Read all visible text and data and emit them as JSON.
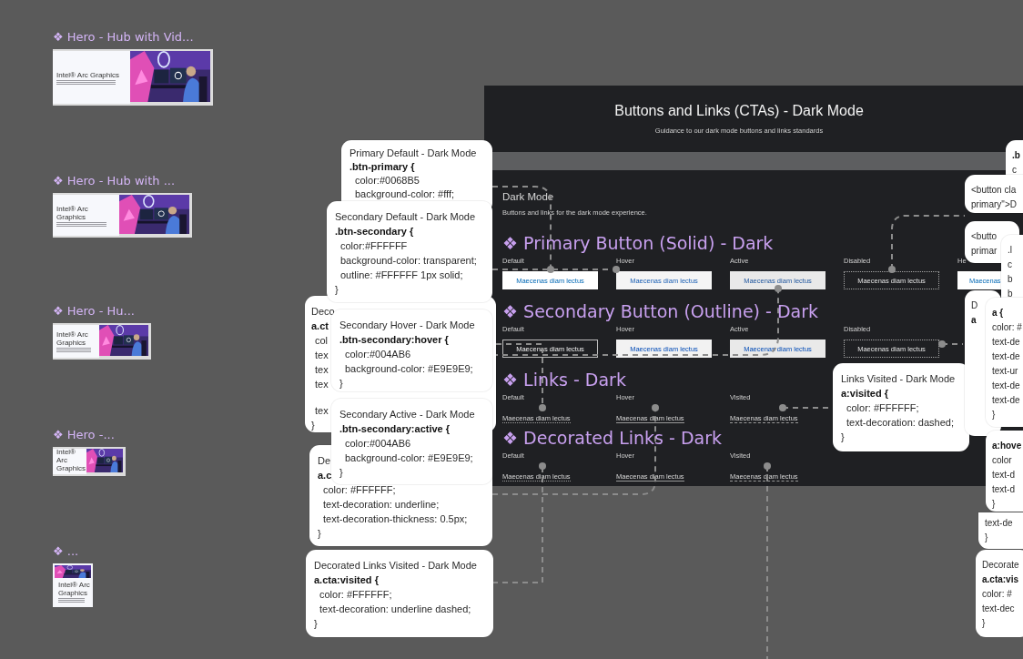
{
  "frames": [
    {
      "label": "❖ Hero - Hub with Vid...",
      "heading": "Intel® Arc Graphics"
    },
    {
      "label": "❖ Hero - Hub with ...",
      "heading": "Intel® Arc Graphics"
    },
    {
      "label": "❖ Hero - Hu...",
      "heading": "Intel® Arc Graphics"
    },
    {
      "label": "❖ Hero -...",
      "heading": "Intel® Arc Graphics"
    },
    {
      "label": "❖ ...",
      "heading": "Intel® Arc Graphics"
    }
  ],
  "board": {
    "title": "Buttons and Links (CTAs) - Dark Mode",
    "subtitle": "Guidance to our dark mode buttons and links standards",
    "section_title": "Dark Mode",
    "section_description": "Buttons and links for the dark mode experience.",
    "groups": [
      {
        "label": "❖ Primary Button (Solid) - Dark",
        "kind": "solid",
        "states": [
          {
            "label": "Default",
            "text": "Maecenas diam lectus",
            "kind": "default"
          },
          {
            "label": "Hover",
            "text": "Maecenas diam lectus",
            "kind": "hover"
          },
          {
            "label": "Active",
            "text": "Maecenas diam lectus",
            "kind": "active"
          },
          {
            "label": "Disabled",
            "text": "Maecenas diam lectus",
            "kind": "disabled"
          },
          {
            "label": "He",
            "text": "Maecenas",
            "kind": "default"
          }
        ]
      },
      {
        "label": "❖ Secondary Button (Outline) - Dark",
        "kind": "outline",
        "states": [
          {
            "label": "Default",
            "text": "Maecenas diam lectus",
            "kind": "default"
          },
          {
            "label": "Hover",
            "text": "Maecenas diam lectus",
            "kind": "hover"
          },
          {
            "label": "Active",
            "text": "Maecenas diam lectus",
            "kind": "active"
          },
          {
            "label": "Disabled",
            "text": "Maecenas diam lectus",
            "kind": "disabled"
          }
        ]
      },
      {
        "label": "❖ Links - Dark",
        "kind": "link",
        "states": [
          {
            "label": "Default",
            "text": "Maecenas diam lectus",
            "kind": "default"
          },
          {
            "label": "Hover",
            "text": "Maecenas diam lectus",
            "kind": "hover"
          },
          {
            "label": "Visited",
            "text": "Maecenas diam lectus",
            "kind": "visited"
          }
        ]
      },
      {
        "label": "❖ Decorated Links - Dark",
        "kind": "link",
        "states": [
          {
            "label": "Default",
            "text": "Maecenas diam lectus",
            "kind": "default"
          },
          {
            "label": "Hover",
            "text": "Maecenas diam lectus",
            "kind": "hover"
          },
          {
            "label": "Visited",
            "text": "Maecenas diam lectus",
            "kind": "visited"
          }
        ]
      }
    ]
  },
  "notes": [
    {
      "lines": [
        {
          "text": "Primary Default - Dark Mode",
          "kind": "title"
        },
        {
          "text": ".btn-primary {",
          "kind": "selector"
        },
        {
          "text": "color:#0068B5",
          "kind": "prop"
        },
        {
          "text": "background-color: #fff;",
          "kind": "prop"
        }
      ]
    },
    {
      "lines": [
        {
          "text": "Deco",
          "kind": "title"
        },
        {
          "text": "a.ct",
          "kind": "selector"
        },
        {
          "text": "col",
          "kind": "prop"
        },
        {
          "text": "tex",
          "kind": "prop"
        },
        {
          "text": "tex",
          "kind": "prop"
        },
        {
          "text": "tex",
          "kind": "prop"
        },
        {
          "text": "tex",
          "kind": "prop"
        },
        {
          "text": "}",
          "kind": "close"
        }
      ]
    },
    {
      "lines": [
        {
          "text": "Secondary Default - Dark Mode",
          "kind": "title"
        },
        {
          "text": ".btn-secondary {",
          "kind": "selector"
        },
        {
          "text": "color:#FFFFFF",
          "kind": "prop"
        },
        {
          "text": "background-color: transparent;",
          "kind": "prop"
        },
        {
          "text": "outline: #FFFFFF 1px solid;",
          "kind": "prop"
        },
        {
          "text": "}",
          "kind": "close"
        }
      ]
    },
    {
      "lines": [
        {
          "text": "Secondary Hover - Dark Mode",
          "kind": "title"
        },
        {
          "text": ".btn-secondary:hover {",
          "kind": "selector"
        },
        {
          "text": "color:#004AB6",
          "kind": "prop"
        },
        {
          "text": "background-color: #E9E9E9;",
          "kind": "prop"
        },
        {
          "text": "}",
          "kind": "close"
        }
      ]
    },
    {
      "lines": [
        {
          "text": "De",
          "kind": "title"
        },
        {
          "text": "a.c",
          "kind": "selector"
        },
        {
          "text": "color: #FFFFFF;",
          "kind": "prop"
        },
        {
          "text": "text-decoration: underline;",
          "kind": "prop"
        },
        {
          "text": "text-decoration-thickness: 0.5px;",
          "kind": "prop"
        },
        {
          "text": "}",
          "kind": "close"
        }
      ]
    },
    {
      "lines": [
        {
          "text": "Secondary Active - Dark Mode",
          "kind": "title"
        },
        {
          "text": ".btn-secondary:active {",
          "kind": "selector"
        },
        {
          "text": "color:#004AB6",
          "kind": "prop"
        },
        {
          "text": "background-color: #E9E9E9;",
          "kind": "prop"
        },
        {
          "text": "}",
          "kind": "close"
        }
      ]
    },
    {
      "lines": [
        {
          "text": "Decorated Links Visited - Dark Mode",
          "kind": "title"
        },
        {
          "text": "a.cta:visited {",
          "kind": "selector"
        },
        {
          "text": "color: #FFFFFF;",
          "kind": "prop"
        },
        {
          "text": "text-decoration: underline dashed;",
          "kind": "prop"
        },
        {
          "text": "}",
          "kind": "close"
        }
      ]
    },
    {
      "lines": [
        {
          "text": "Links Visited - Dark Mode",
          "kind": "title"
        },
        {
          "text": "a:visited {",
          "kind": "selector"
        },
        {
          "text": "color: #FFFFFF;",
          "kind": "prop"
        },
        {
          "text": "text-decoration: dashed;",
          "kind": "prop"
        },
        {
          "text": "}",
          "kind": "close"
        }
      ]
    },
    {
      "lines": [
        {
          "text": ".b",
          "kind": "selector"
        },
        {
          "text": "c",
          "kind": "prop"
        }
      ]
    },
    {
      "lines": [
        {
          "text": "<button cla",
          "kind": "title"
        },
        {
          "text": "primary\">D",
          "kind": "title"
        }
      ]
    },
    {
      "lines": [
        {
          "text": "<butto",
          "kind": "title"
        },
        {
          "text": "primar",
          "kind": "title"
        }
      ]
    },
    {
      "lines": [
        {
          "text": ".l",
          "kind": "title"
        },
        {
          "text": "c",
          "kind": "title"
        },
        {
          "text": "b",
          "kind": "title"
        },
        {
          "text": "b",
          "kind": "title"
        }
      ]
    },
    {
      "lines": [
        {
          "text": "D",
          "kind": "title"
        },
        {
          "text": "a",
          "kind": "selector"
        }
      ]
    },
    {
      "lines": [
        {
          "text": "a {",
          "kind": "selector"
        },
        {
          "text": "color: #",
          "kind": "title"
        },
        {
          "text": "text-de",
          "kind": "title"
        },
        {
          "text": "text-de",
          "kind": "title"
        },
        {
          "text": "text-ur",
          "kind": "title"
        },
        {
          "text": "text-de",
          "kind": "title"
        },
        {
          "text": "text-de",
          "kind": "title"
        },
        {
          "text": "}",
          "kind": "close"
        }
      ]
    },
    {
      "lines": [
        {
          "text": "a:hove",
          "kind": "selector"
        },
        {
          "text": "color",
          "kind": "prop"
        },
        {
          "text": "text-d",
          "kind": "prop"
        },
        {
          "text": "text-d",
          "kind": "prop"
        },
        {
          "text": "}",
          "kind": "close"
        }
      ]
    },
    {
      "lines": [
        {
          "text": "text-de",
          "kind": "prop"
        },
        {
          "text": "}",
          "kind": "close"
        }
      ]
    },
    {
      "lines": [
        {
          "text": "Decorate",
          "kind": "title"
        },
        {
          "text": "a.cta:vis",
          "kind": "selector"
        },
        {
          "text": "color: #",
          "kind": "prop"
        },
        {
          "text": "text-dec",
          "kind": "prop"
        },
        {
          "text": "}",
          "kind": "close"
        }
      ]
    }
  ]
}
